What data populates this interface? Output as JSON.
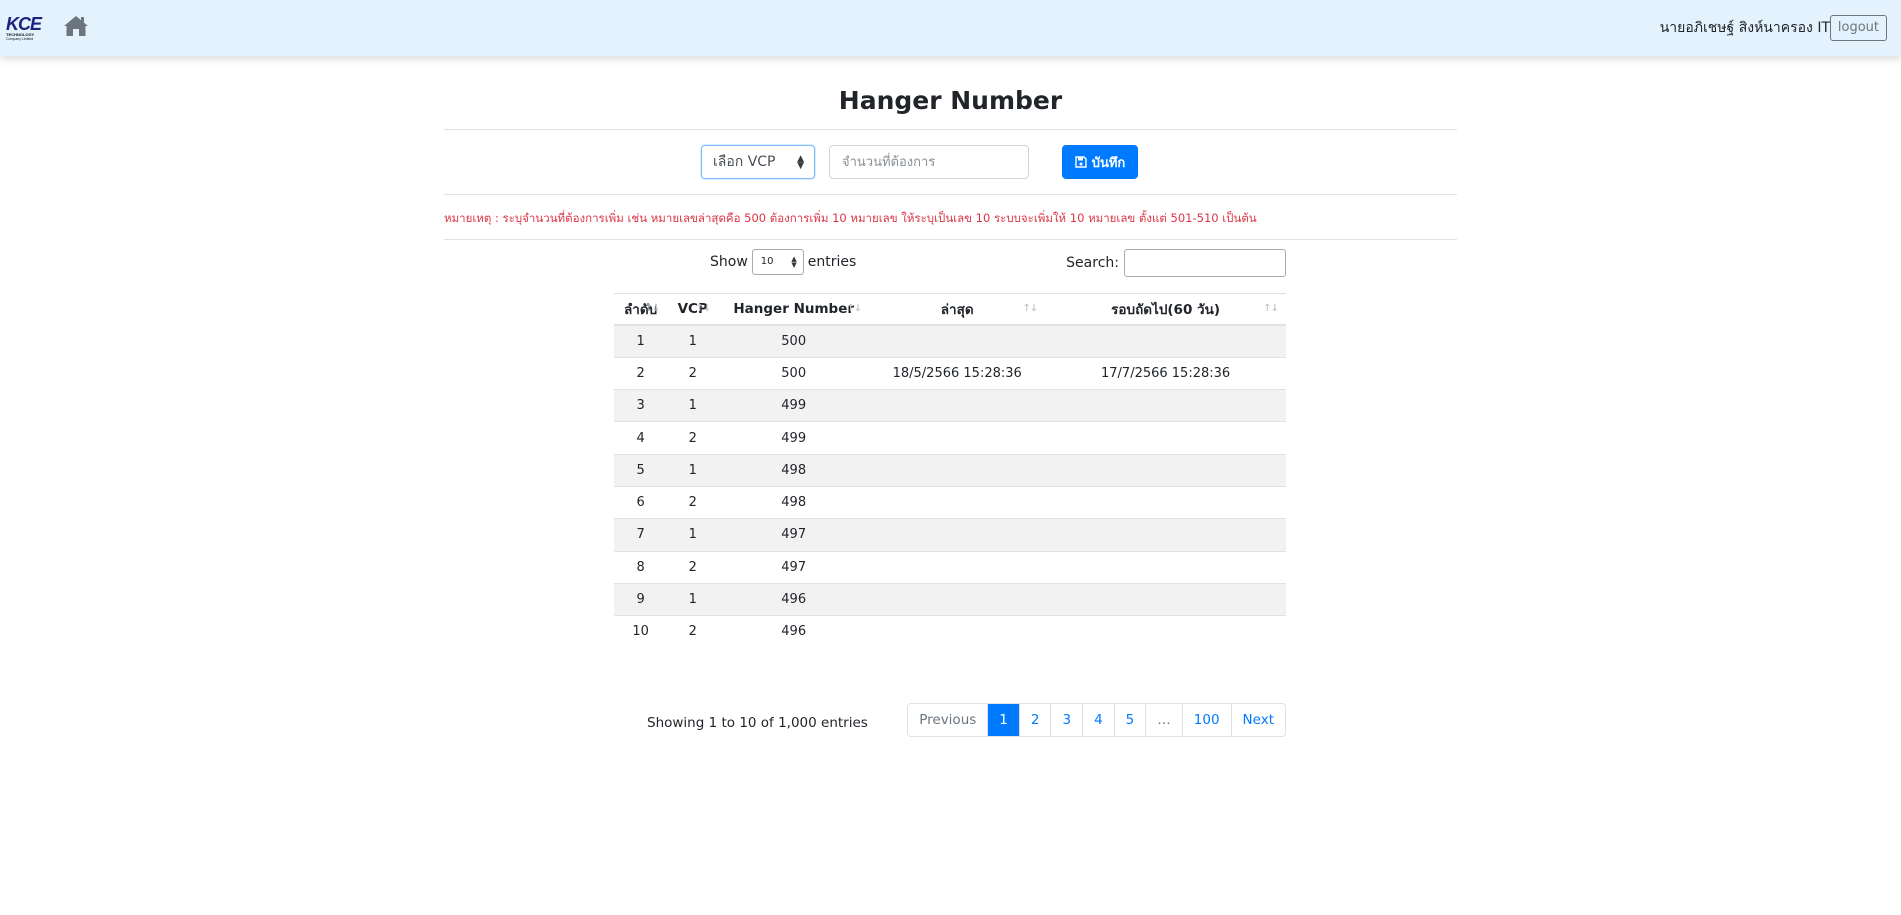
{
  "navbar": {
    "logo_text": "KCE",
    "logo_sub1": "TECHNOLOGY",
    "logo_sub2": "Company Limited",
    "home_icon": "home-icon",
    "user_name": "นายอภิเชษฐ์ สิงห์นาครอง IT",
    "logout_label": "logout"
  },
  "page": {
    "title": "Hanger Number",
    "vcp_select_value": "เลือก VCP",
    "qty_placeholder": "จำนวนที่ต้องการ",
    "save_label": "บันทึก",
    "save_icon": "save-icon",
    "note": "หมายเหตุ : ระบุจำนวนที่ต้องการเพิ่ม เช่น หมายเลขล่าสุดคือ 500 ต้องการเพิ่ม 10 หมายเลข ให้ระบุเป็นเลข 10 ระบบจะเพิ่มให้ 10 หมายเลข ตั้งแต่ 501-510 เป็นต้น"
  },
  "table": {
    "show_label": "Show",
    "entries_label": "entries",
    "page_length": "10",
    "search_label": "Search:",
    "columns": [
      "ลำดับ",
      "VCP",
      "Hanger Number",
      "ล่าสุด",
      "รอบถัดไป(60 วัน)"
    ],
    "rows": [
      [
        "1",
        "1",
        "500",
        "",
        ""
      ],
      [
        "2",
        "2",
        "500",
        "18/5/2566 15:28:36",
        "17/7/2566 15:28:36"
      ],
      [
        "3",
        "1",
        "499",
        "",
        ""
      ],
      [
        "4",
        "2",
        "499",
        "",
        ""
      ],
      [
        "5",
        "1",
        "498",
        "",
        ""
      ],
      [
        "6",
        "2",
        "498",
        "",
        ""
      ],
      [
        "7",
        "1",
        "497",
        "",
        ""
      ],
      [
        "8",
        "2",
        "497",
        "",
        ""
      ],
      [
        "9",
        "1",
        "496",
        "",
        ""
      ],
      [
        "10",
        "2",
        "496",
        "",
        ""
      ]
    ],
    "info": "Showing 1 to 10 of 1,000 entries",
    "pagination": [
      "Previous",
      "1",
      "2",
      "3",
      "4",
      "5",
      "…",
      "100",
      "Next"
    ],
    "active_page": "1"
  },
  "colors": {
    "navbar_bg": "#e3f2fd",
    "primary": "#007bff",
    "danger": "#dc3545",
    "stripe": "#f2f2f2"
  }
}
